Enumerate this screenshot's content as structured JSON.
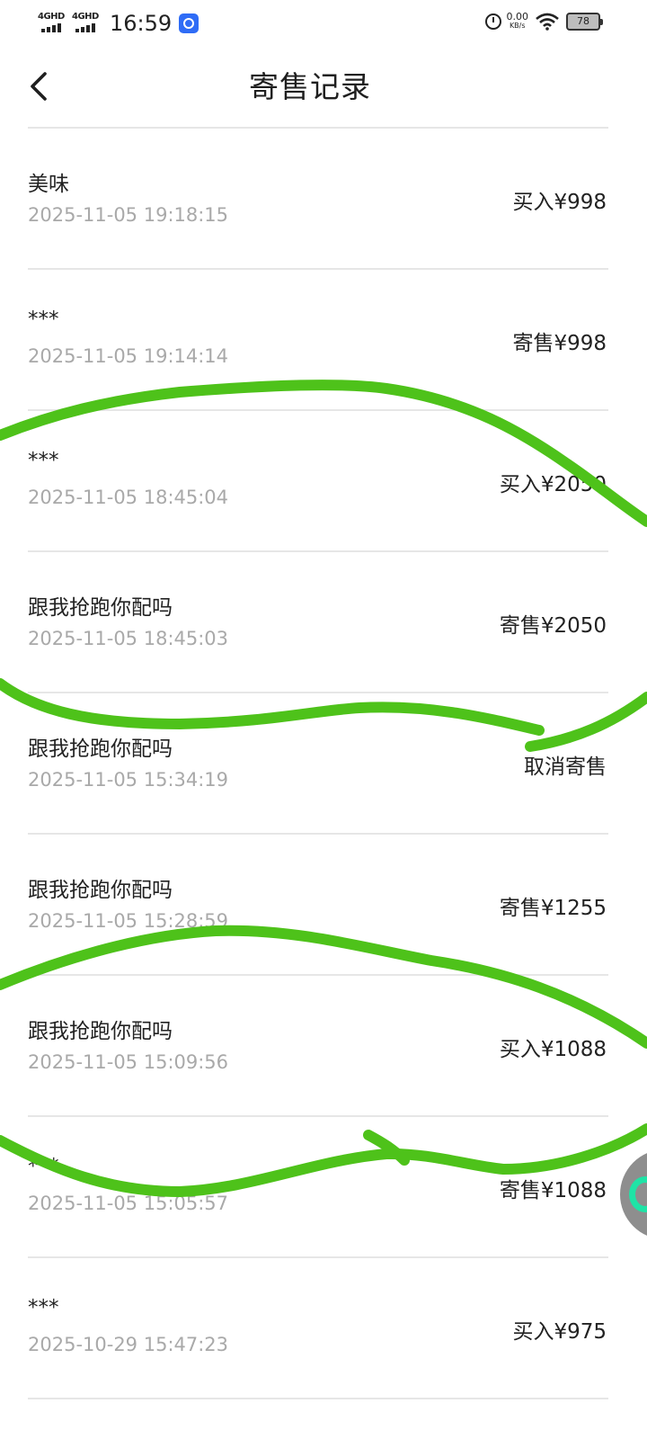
{
  "status_bar": {
    "network_1": "4GHD",
    "network_2": "4GHD",
    "time": "16:59",
    "speed_value": "0.00",
    "speed_unit": "KB/s",
    "battery": "78"
  },
  "header": {
    "title": "寄售记录"
  },
  "records": [
    {
      "name": "美味",
      "time": "2025-11-05 19:18:15",
      "amount": "买入¥998"
    },
    {
      "name": "***",
      "time": "2025-11-05 19:14:14",
      "amount": "寄售¥998"
    },
    {
      "name": "***",
      "time": "2025-11-05 18:45:04",
      "amount": "买入¥2050"
    },
    {
      "name": "跟我抢跑你配吗",
      "time": "2025-11-05 18:45:03",
      "amount": "寄售¥2050"
    },
    {
      "name": "跟我抢跑你配吗",
      "time": "2025-11-05 15:34:19",
      "amount": "取消寄售"
    },
    {
      "name": "跟我抢跑你配吗",
      "time": "2025-11-05 15:28:59",
      "amount": "寄售¥1255"
    },
    {
      "name": "跟我抢跑你配吗",
      "time": "2025-11-05 15:09:56",
      "amount": "买入¥1088"
    },
    {
      "name": "***",
      "time": "2025-11-05 15:05:57",
      "amount": "寄售¥1088"
    },
    {
      "name": "***",
      "time": "2025-10-29 15:47:23",
      "amount": "买入¥975"
    }
  ],
  "colors": {
    "annotation_stroke": "#4ec21a",
    "divider": "#e6e6e6",
    "secondary_text": "#a9a9a9",
    "bubble_accent": "#1fe3a6"
  },
  "icons": {
    "back": "chevron-left-icon",
    "alarm": "alarm-clock-icon",
    "wifi": "wifi-icon",
    "battery": "battery-icon",
    "signal": "signal-bars-icon",
    "app": "app-badge-icon"
  }
}
